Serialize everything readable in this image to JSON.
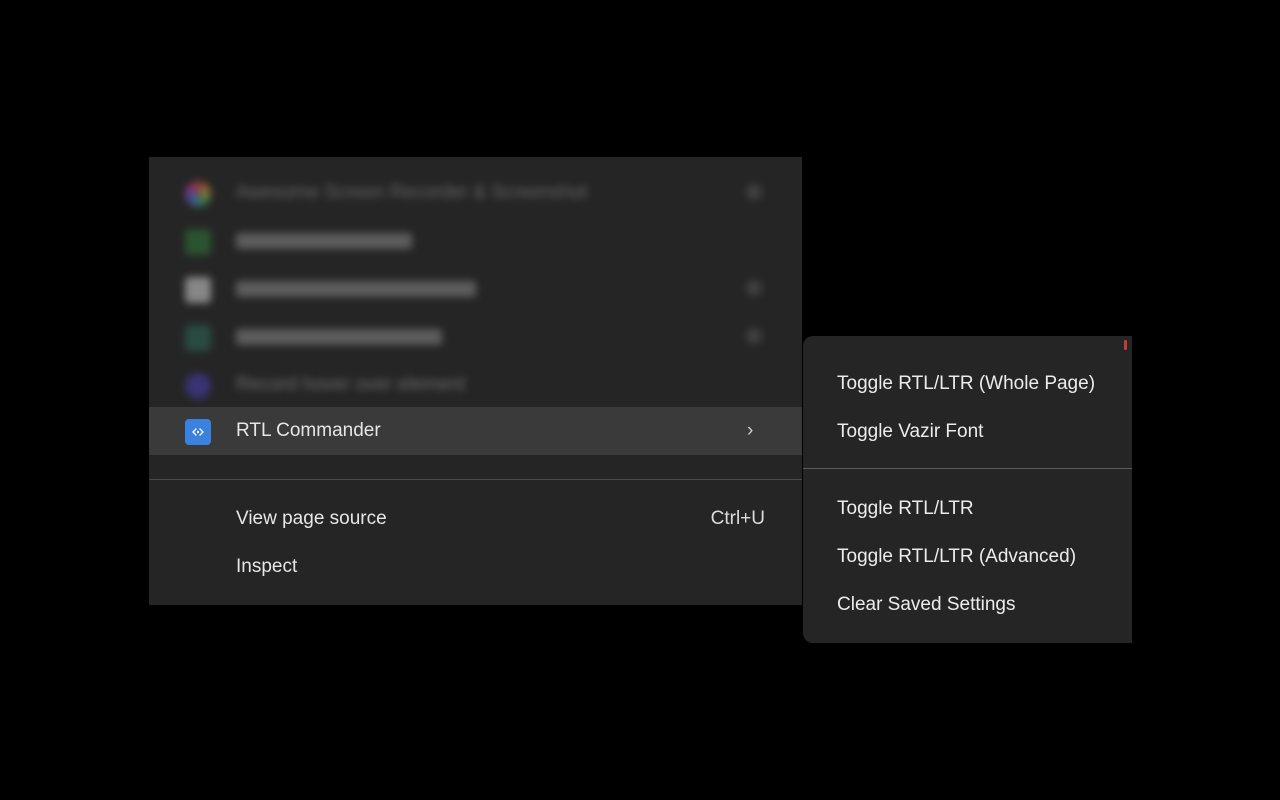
{
  "menu": {
    "blurred_items": [
      {
        "label": "Awesome Screen Recorder & Screenshot",
        "icon": "colorful-ring-icon",
        "has_submenu": true
      },
      {
        "label": "Extension item blurred",
        "icon": "green-extension-icon",
        "has_submenu": false
      },
      {
        "label": "Extension item blurred",
        "icon": "white-extension-icon",
        "has_submenu": false
      },
      {
        "label": "Extension item blurred",
        "icon": "teal-extension-icon",
        "has_submenu": false
      },
      {
        "label": "Record hover over element",
        "icon": "purple-d-icon",
        "has_submenu": false
      }
    ],
    "active_item": {
      "label": "RTL Commander",
      "icon": "rtl-commander-icon",
      "chevron": "›"
    },
    "view_source": {
      "label": "View page source",
      "shortcut": "Ctrl+U"
    },
    "inspect": {
      "label": "Inspect"
    }
  },
  "submenu": {
    "group1": [
      {
        "label": "Toggle RTL/LTR (Whole Page)"
      },
      {
        "label": "Toggle Vazir Font"
      }
    ],
    "group2": [
      {
        "label": "Toggle RTL/LTR"
      },
      {
        "label": "Toggle RTL/LTR (Advanced)"
      },
      {
        "label": "Clear Saved Settings"
      }
    ]
  },
  "colors": {
    "background": "#000000",
    "menu_bg": "#252525",
    "highlight_bg": "#3a3a3a",
    "accent_blue": "#3b82e0"
  }
}
